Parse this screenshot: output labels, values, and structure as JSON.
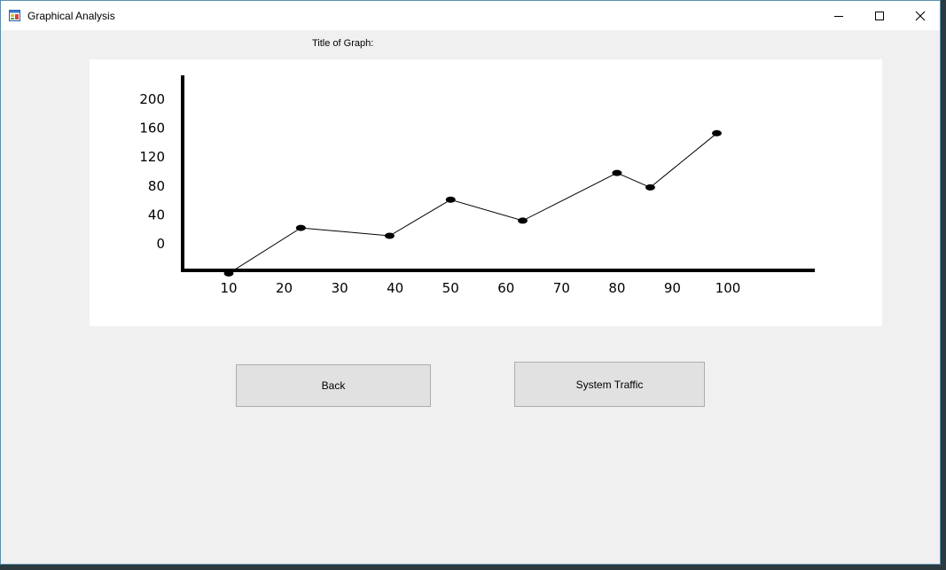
{
  "window": {
    "title": "Graphical Analysis",
    "app_icon": "app-window-icon"
  },
  "title_controls": {
    "minimize_icon": "minimize-icon",
    "maximize_icon": "maximize-icon",
    "close_icon": "close-icon"
  },
  "graph_title_label": "Title of Graph:",
  "buttons": {
    "back": "Back",
    "system_traffic": "System Traffic"
  },
  "chart_data": {
    "type": "line",
    "title": "",
    "xlabel": "",
    "ylabel": "",
    "x_ticks": [
      "10",
      "20",
      "30",
      "40",
      "50",
      "60",
      "70",
      "80",
      "90",
      "100"
    ],
    "y_ticks": [
      "200",
      "160",
      "120",
      "80",
      "40",
      "0"
    ],
    "xlim": [
      10,
      100
    ],
    "ylim": [
      0,
      200
    ],
    "series": [
      {
        "x": [
          10,
          23,
          39,
          50,
          63,
          80,
          86,
          98
        ],
        "y": [
          -41,
          22,
          11,
          61,
          32,
          98,
          78,
          153
        ]
      }
    ],
    "grid": false,
    "legend": "none"
  }
}
